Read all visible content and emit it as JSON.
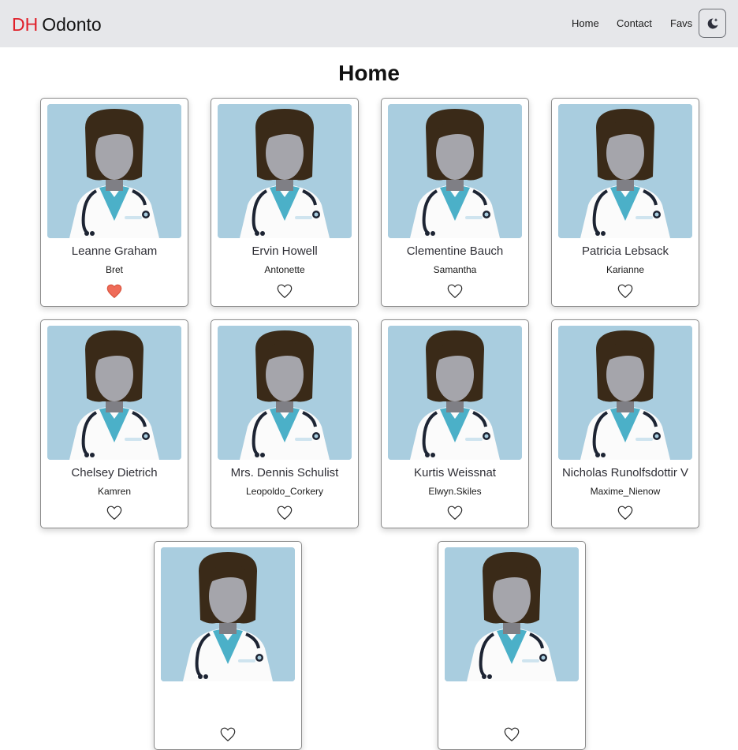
{
  "nav": {
    "brand_prefix": "DH",
    "brand_name": "Odonto",
    "links": [
      "Home",
      "Contact",
      "Favs"
    ],
    "theme_icon": "moon-star-icon"
  },
  "page": {
    "title": "Home"
  },
  "colors": {
    "navbar_bg": "#e6e7ea",
    "brand_red": "#e0202a",
    "photo_bg": "#a9cddf",
    "fav_active": "#ef6b58"
  },
  "dentists": [
    {
      "name": "Leanne Graham",
      "username": "Bret",
      "favorite": true
    },
    {
      "name": "Ervin Howell",
      "username": "Antonette",
      "favorite": false
    },
    {
      "name": "Clementine Bauch",
      "username": "Samantha",
      "favorite": false
    },
    {
      "name": "Patricia Lebsack",
      "username": "Karianne",
      "favorite": false
    },
    {
      "name": "Chelsey Dietrich",
      "username": "Kamren",
      "favorite": false
    },
    {
      "name": "Mrs. Dennis Schulist",
      "username": "Leopoldo_Corkery",
      "favorite": false
    },
    {
      "name": "Kurtis Weissnat",
      "username": "Elwyn.Skiles",
      "favorite": false
    },
    {
      "name": "Nicholas Runolfsdottir V",
      "username": "Maxime_Nienow",
      "favorite": false
    },
    {
      "name": "",
      "username": "",
      "favorite": false
    },
    {
      "name": "",
      "username": "",
      "favorite": false
    }
  ]
}
